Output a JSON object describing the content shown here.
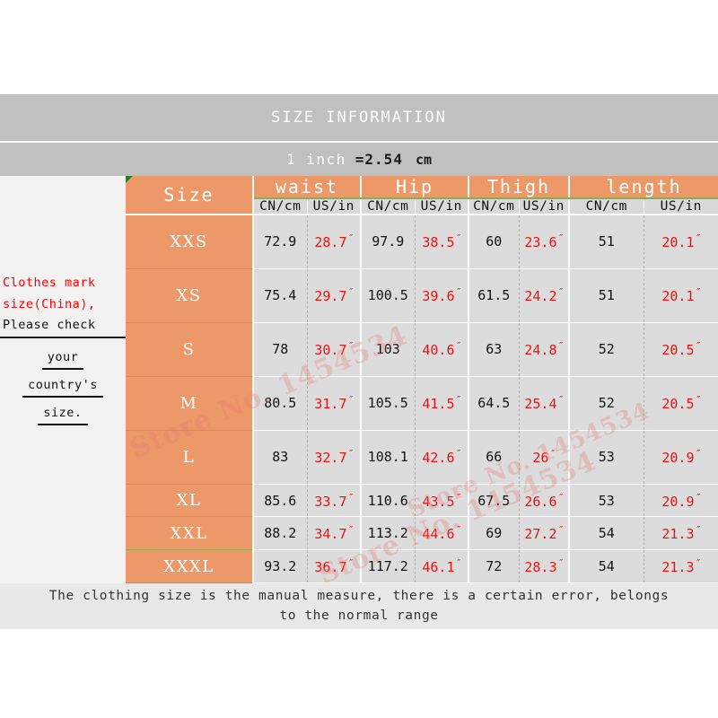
{
  "header": {
    "title": "SIZE INFORMATION",
    "conversion_prefix": "1 inch",
    "conversion_value": "=2.54",
    "conversion_unit": "cm"
  },
  "note_panel": {
    "line1": "Clothes mark",
    "line2": "size(China),",
    "line3": "Please check",
    "line4": "your",
    "line5": "country's",
    "line6": "size."
  },
  "table": {
    "size_header": "Size",
    "groups": [
      {
        "label": "waist",
        "units": [
          "CN/cm",
          "US/in"
        ]
      },
      {
        "label": "Hip",
        "units": [
          "CN/cm",
          "US/in"
        ]
      },
      {
        "label": "Thigh",
        "units": [
          "CN/cm",
          "US/in"
        ]
      },
      {
        "label": "length",
        "units": [
          "CN/cm",
          "US/in"
        ]
      }
    ],
    "inch_symbol": "″",
    "rows": [
      {
        "size": "XXS",
        "waist_cn": "72.9",
        "waist_us": "28.7",
        "hip_cn": "97.9",
        "hip_us": "38.5",
        "thigh_cn": "60",
        "thigh_us": "23.6",
        "length_cn": "51",
        "length_us": "20.1"
      },
      {
        "size": "XS",
        "waist_cn": "75.4",
        "waist_us": "29.7",
        "hip_cn": "100.5",
        "hip_us": "39.6",
        "thigh_cn": "61.5",
        "thigh_us": "24.2",
        "length_cn": "51",
        "length_us": "20.1"
      },
      {
        "size": "S",
        "waist_cn": "78",
        "waist_us": "30.7",
        "hip_cn": "103",
        "hip_us": "40.6",
        "thigh_cn": "63",
        "thigh_us": "24.8",
        "length_cn": "52",
        "length_us": "20.5"
      },
      {
        "size": "M",
        "waist_cn": "80.5",
        "waist_us": "31.7",
        "hip_cn": "105.5",
        "hip_us": "41.5",
        "thigh_cn": "64.5",
        "thigh_us": "25.4",
        "length_cn": "52",
        "length_us": "20.5"
      },
      {
        "size": "L",
        "waist_cn": "83",
        "waist_us": "32.7",
        "hip_cn": "108.1",
        "hip_us": "42.6",
        "thigh_cn": "66",
        "thigh_us": "26",
        "length_cn": "53",
        "length_us": "20.9"
      },
      {
        "size": "XL",
        "waist_cn": "85.6",
        "waist_us": "33.7",
        "hip_cn": "110.6",
        "hip_us": "43.5",
        "thigh_cn": "67.5",
        "thigh_us": "26.6",
        "length_cn": "53",
        "length_us": "20.9"
      },
      {
        "size": "XXL",
        "waist_cn": "88.2",
        "waist_us": "34.7",
        "hip_cn": "113.2",
        "hip_us": "44.6",
        "thigh_cn": "69",
        "thigh_us": "27.2",
        "length_cn": "54",
        "length_us": "21.3"
      },
      {
        "size": "XXXL",
        "waist_cn": "93.2",
        "waist_us": "36.7",
        "hip_cn": "117.2",
        "hip_us": "46.1",
        "thigh_cn": "72",
        "thigh_us": "28.3",
        "length_cn": "54",
        "length_us": "21.3"
      }
    ]
  },
  "footer": {
    "line1": "The clothing size is the manual measure, there is a certain error, belongs",
    "line2": "to the normal range"
  },
  "watermark": {
    "text": "Store No. 1454534"
  },
  "colors": {
    "orange": "#ed9868",
    "band_gray": "#c0c0c0",
    "cell_gray": "#dcdcdc",
    "panel_gray": "#f2f2f2",
    "red_text": "#ee1111",
    "footer_gray": "#e8e8e8"
  }
}
